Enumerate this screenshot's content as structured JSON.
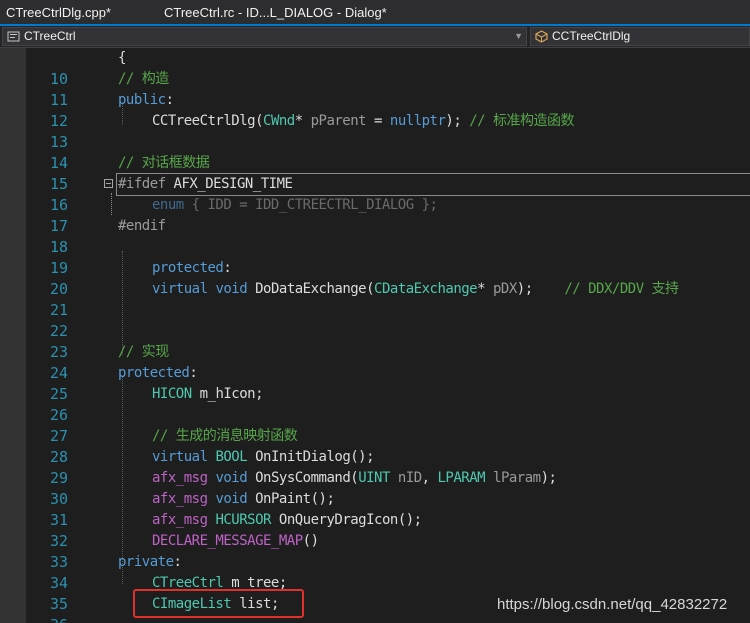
{
  "tabs": [
    {
      "label": "CTreeCtrlDlg.cpp*"
    },
    {
      "label": "CTreeCtrl.rc - ID...L_DIALOG - Dialog*"
    }
  ],
  "navbar": {
    "project_combo": "CTreeCtrl",
    "class_combo": "CCTreeCtrlDlg"
  },
  "line_numbers": [
    "10",
    "11",
    "12",
    "13",
    "14",
    "15",
    "16",
    "17",
    "18",
    "19",
    "20",
    "21",
    "22",
    "23",
    "24",
    "25",
    "26",
    "27",
    "28",
    "29",
    "30",
    "31",
    "32",
    "33",
    "34",
    "35",
    "36"
  ],
  "code": {
    "l10": [
      "{"
    ],
    "l11": [
      "// 构造"
    ],
    "l12": [
      "public",
      ":"
    ],
    "l13": [
      "CCTreeCtrlDlg(",
      "CWnd",
      "* ",
      "pParent",
      " = ",
      "nullptr",
      "); ",
      "// 标准构造函数"
    ],
    "l14": [],
    "l15": [
      "// 对话框数据"
    ],
    "l16": [
      "#ifdef ",
      "AFX_DESIGN_TIME"
    ],
    "l17": [
      "enum",
      " { IDD = IDD_CTREECTRL_DIALOG };"
    ],
    "l18": [
      "#endif"
    ],
    "l19": [],
    "l20": [
      "protected",
      ":"
    ],
    "l21": [
      "virtual",
      " ",
      "void",
      " DoDataExchange(",
      "CDataExchange",
      "* ",
      "pDX",
      ");    ",
      "// DDX/DDV 支持"
    ],
    "l22": [],
    "l23": [],
    "l24": [
      "// 实现"
    ],
    "l25": [
      "protected",
      ":"
    ],
    "l26": [
      "HICON",
      " m_hIcon;"
    ],
    "l27": [],
    "l28": [
      "// 生成的消息映射函数"
    ],
    "l29": [
      "virtual",
      " ",
      "BOOL",
      " OnInitDialog",
      "();"
    ],
    "l30": [
      "afx_msg",
      " ",
      "void",
      " OnSysCommand(",
      "UINT",
      " ",
      "nID",
      ", ",
      "LPARAM",
      " ",
      "lParam",
      ");"
    ],
    "l31": [
      "afx_msg",
      " ",
      "void",
      " OnPaint",
      "();"
    ],
    "l32": [
      "afx_msg",
      " ",
      "HCURSOR",
      " OnQueryDragIcon",
      "();"
    ],
    "l33": [
      "DECLARE_MESSAGE_MAP",
      "()"
    ],
    "l34": [
      "private",
      ":"
    ],
    "l35": [
      "CTreeCtrl",
      " m_tree;"
    ],
    "l36": [
      "CImageList",
      " list;"
    ]
  },
  "watermark": "https://blog.csdn.net/qq_42832272",
  "colors": {
    "keyword": "#569cd6",
    "type": "#4ec9b0",
    "comment": "#57a64a",
    "macro": "#bd63c5",
    "line_number": "#2b91af",
    "highlight_box": "#e0302b"
  }
}
